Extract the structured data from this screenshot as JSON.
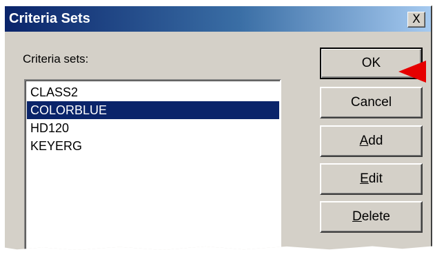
{
  "window": {
    "title": "Criteria Sets",
    "close_glyph": "X"
  },
  "criteria_list": {
    "label": "Criteria sets:",
    "items": [
      "CLASS2",
      "COLORBLUE",
      "HD120",
      "KEYERG"
    ],
    "selected_item": "COLORBLUE"
  },
  "buttons": {
    "ok": "OK",
    "cancel": "Cancel",
    "add": {
      "mnemonic": "A",
      "rest": "dd"
    },
    "edit": {
      "mnemonic": "E",
      "rest": "dit"
    },
    "delete": {
      "mnemonic": "D",
      "rest": "elete"
    }
  },
  "annotation": {
    "icon": "red-arrow-pointer",
    "color": "#e60000"
  },
  "colors": {
    "title_bar_start": "#0a246a",
    "title_bar_end": "#a6caf0",
    "selection": "#0a246a",
    "dialog_face": "#d4d0c8"
  }
}
